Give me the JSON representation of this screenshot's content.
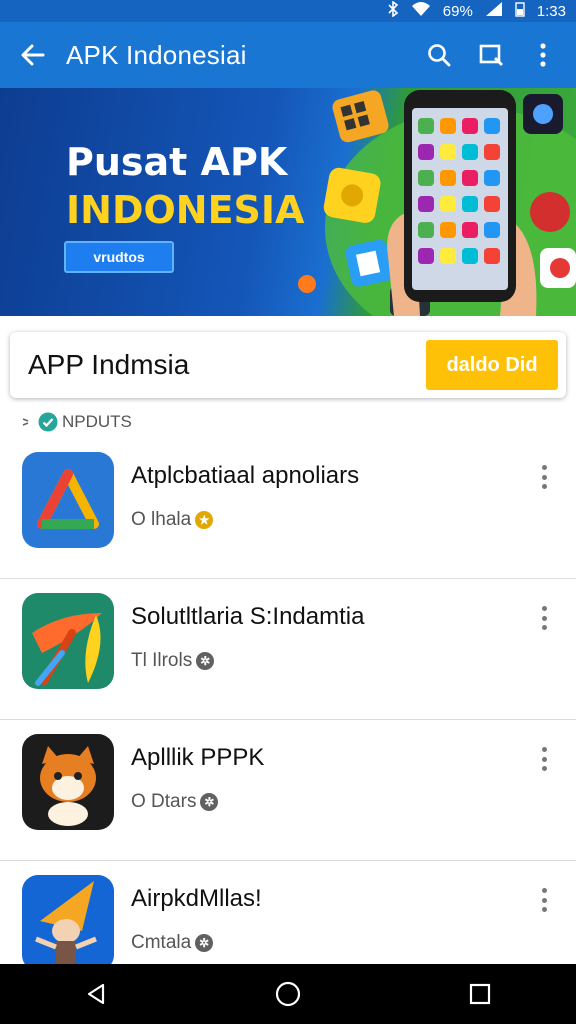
{
  "status_bar": {
    "battery": "69%",
    "time": "1:33",
    "icons": [
      "bluetooth-icon",
      "wifi-icon",
      "signal-icon",
      "battery-icon"
    ]
  },
  "app_bar": {
    "title": "APK Indonesiai",
    "icons": [
      "back-arrow-icon",
      "search-icon",
      "window-icon",
      "more-vert-icon"
    ]
  },
  "banner": {
    "line1": "Pusat APK",
    "line2": "INDONESIA",
    "button_label": "vrudtos"
  },
  "search": {
    "query": "APP Indmsia",
    "button_label": "daldo Did"
  },
  "section": {
    "label": "NPDUTS"
  },
  "apps": [
    {
      "name": "Atplcbatiaal apnoliars",
      "sub": "O lhala",
      "badge_color": "#e0a800"
    },
    {
      "name": "Solutltlaria S:Indamtia",
      "sub": "Tl Ilrols",
      "badge_color": "#616161"
    },
    {
      "name": "Aplllik PPPK",
      "sub": "O Dtars",
      "badge_color": "#616161"
    },
    {
      "name": "AirpkdMllas!",
      "sub": "Cmtala",
      "badge_color": "#616161"
    }
  ],
  "colors": {
    "primary": "#1976d2",
    "status_bar": "#1565c0",
    "accent": "#ffc107"
  }
}
